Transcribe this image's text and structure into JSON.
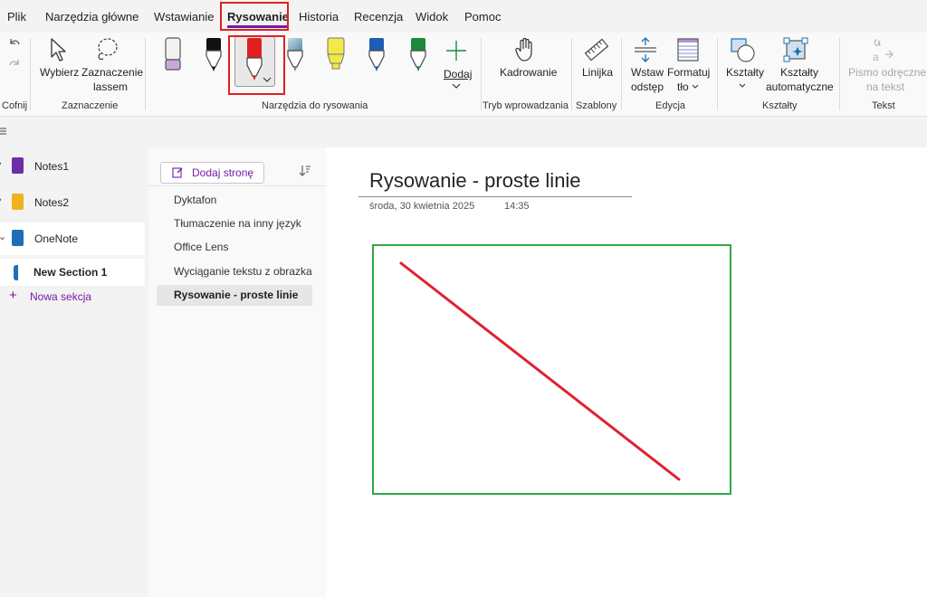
{
  "menu": {
    "items": [
      "Plik",
      "Narzędzia główne",
      "Wstawianie",
      "Rysowanie",
      "Historia",
      "Recenzja",
      "Widok",
      "Pomoc"
    ],
    "active_index": 3
  },
  "ribbon": {
    "undo": {
      "group": "Cofnij"
    },
    "selection": {
      "group": "Zaznaczenie",
      "select_label": "Wybierz",
      "lasso_label_1": "Zaznaczenie",
      "lasso_label_2": "lassem"
    },
    "drawing_tools": {
      "group": "Narzędzia do rysowania",
      "add_label": "Dodaj",
      "pens": [
        {
          "name": "eraser",
          "color": "#c9a9d8"
        },
        {
          "name": "black-pen",
          "color": "#111111"
        },
        {
          "name": "red-pen",
          "color": "#e0201f",
          "selected": true
        },
        {
          "name": "galaxy-pen",
          "color": "#8fb7c9"
        },
        {
          "name": "yellow-highlighter",
          "color": "#f2e84a"
        },
        {
          "name": "blue-pen",
          "color": "#1b5eb3"
        },
        {
          "name": "green-pen",
          "color": "#1b8a3c"
        }
      ]
    },
    "input_mode": {
      "group": "Tryb wprowadzania",
      "label": "Kadrowanie"
    },
    "stencils": {
      "group": "Szablony",
      "label": "Linijka"
    },
    "edit": {
      "group": "Edycja",
      "insert_space_1": "Wstaw",
      "insert_space_2": "odstęp",
      "format_bg_1": "Formatuj",
      "format_bg_2": "tło"
    },
    "shapes": {
      "group": "Kształty",
      "shapes_label": "Kształty",
      "auto_1": "Kształty",
      "auto_2": "automatyczne"
    },
    "text": {
      "group": "Tekst",
      "ink_1": "Pismo odręczne",
      "ink_2": "na tekst"
    }
  },
  "notebooks": [
    {
      "name": "Notes1",
      "color": "#6b2fa8"
    },
    {
      "name": "Notes2",
      "color": "#f2b21f"
    },
    {
      "name": "OneNote",
      "color": "#1d6fb5",
      "expanded": true
    }
  ],
  "sections": [
    {
      "name": "New Section 1",
      "selected": true,
      "color": "#1d6fb5"
    }
  ],
  "new_section_label": "Nowa sekcja",
  "pages_panel": {
    "add_page_label": "Dodaj stronę",
    "pages": [
      "Dyktafon",
      "Tłumaczenie na inny język",
      "Office Lens",
      "Wyciąganie tekstu z obrazka",
      "Rysowanie - proste linie"
    ],
    "selected_index": 4
  },
  "page": {
    "title": "Rysowanie - proste linie",
    "date": "środa, 30 kwietnia 2025",
    "time": "14:35"
  },
  "colors": {
    "accent": "#7719aa",
    "highlight_box": "#e02020",
    "ink_line": "#e0202f",
    "frame": "#2ea84a"
  }
}
